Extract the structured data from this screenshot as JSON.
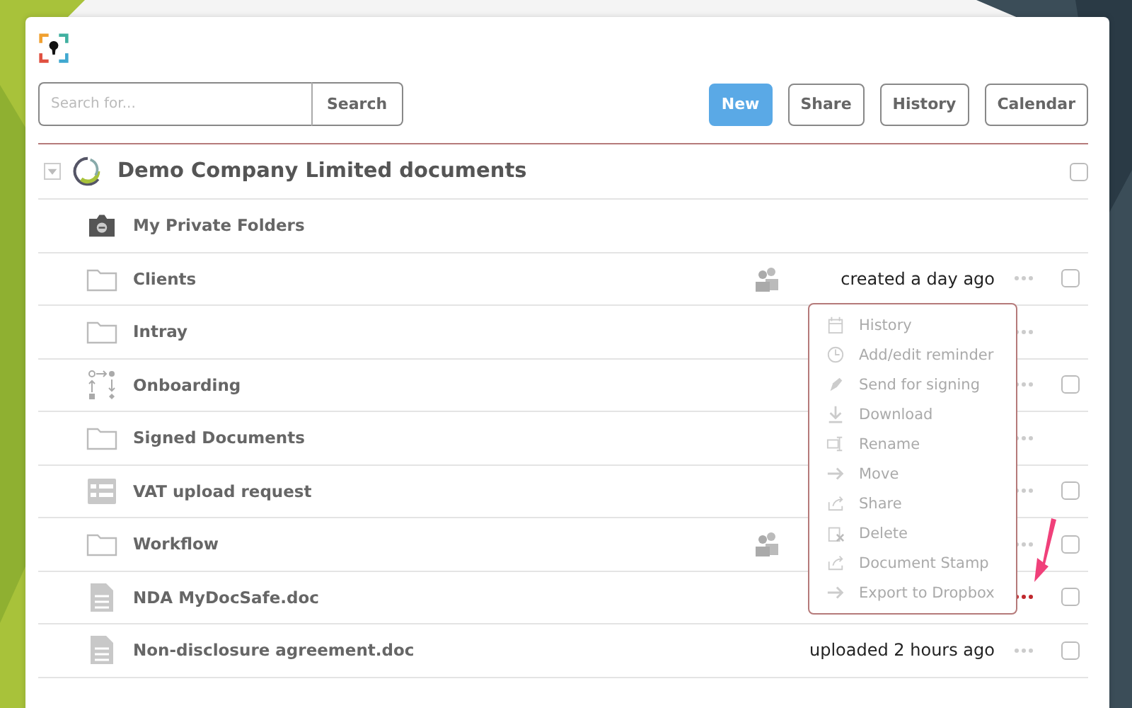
{
  "search": {
    "placeholder": "Search for...",
    "button": "Search"
  },
  "toolbar": [
    {
      "label": "New",
      "kind": "primary"
    },
    {
      "label": "Share",
      "kind": "plain"
    },
    {
      "label": "History",
      "kind": "plain"
    },
    {
      "label": "Calendar",
      "kind": "plain"
    }
  ],
  "root": {
    "title": "Demo Company Limited documents",
    "expanded": true,
    "checked": false
  },
  "rows": [
    {
      "name": "My Private Folders",
      "kind": "private"
    },
    {
      "name": "Clients",
      "kind": "folder",
      "shared": true,
      "date": "created a day ago",
      "more": {
        "open": false
      },
      "checked": false
    },
    {
      "name": "Intray",
      "kind": "folder",
      "shared": false,
      "more": {
        "open": false
      }
    },
    {
      "name": "Onboarding",
      "kind": "workflow",
      "shared": false,
      "more": {
        "open": false
      },
      "checked": false
    },
    {
      "name": "Signed Documents",
      "kind": "folder",
      "shared": false,
      "more": {
        "open": false
      }
    },
    {
      "name": "VAT upload request",
      "kind": "form",
      "shared": false,
      "more": {
        "open": false
      },
      "checked": false
    },
    {
      "name": "Workflow",
      "kind": "folder",
      "shared": true,
      "more": {
        "open": false
      },
      "checked": false
    },
    {
      "name": "NDA MyDocSafe.doc",
      "kind": "document",
      "shared": false,
      "more": {
        "open": true
      },
      "checked": false
    },
    {
      "name": "Non-disclosure agreement.doc",
      "kind": "document",
      "shared": false,
      "date": "uploaded 2 hours ago",
      "more": {
        "open": false
      },
      "checked": false
    }
  ],
  "context_menu": [
    {
      "label": "History",
      "kind": "calendar"
    },
    {
      "label": "Add/edit reminder",
      "kind": "clock"
    },
    {
      "label": "Send for signing",
      "kind": "pen"
    },
    {
      "label": "Download",
      "kind": "download"
    },
    {
      "label": "Rename",
      "kind": "rename"
    },
    {
      "label": "Move",
      "kind": "arrow"
    },
    {
      "label": "Share",
      "kind": "share"
    },
    {
      "label": "Delete",
      "kind": "delete"
    },
    {
      "label": "Document Stamp",
      "kind": "share"
    },
    {
      "label": "Export to Dropbox",
      "kind": "arrow"
    }
  ]
}
